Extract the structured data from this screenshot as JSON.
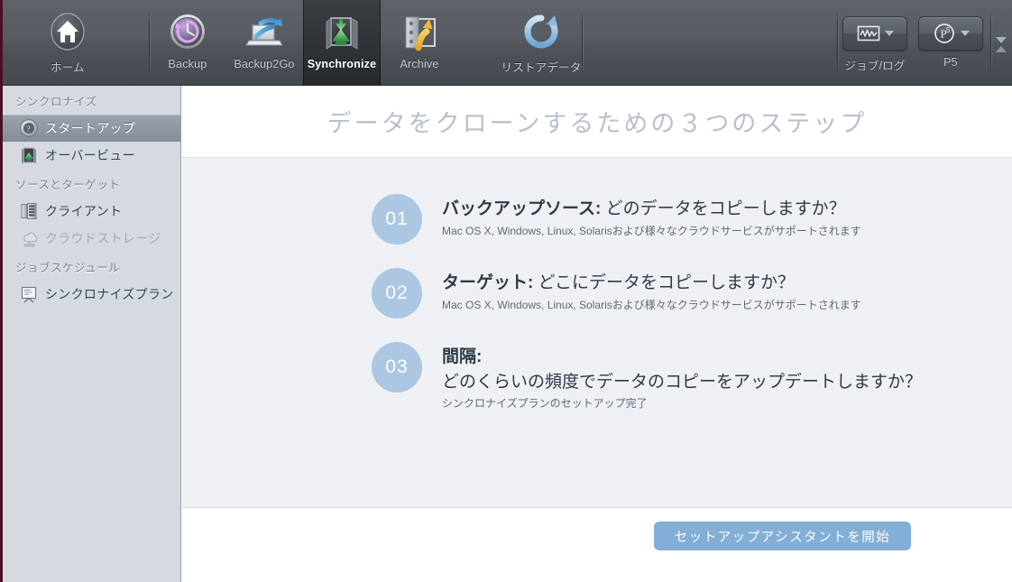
{
  "toolbar": {
    "items": [
      {
        "id": "home",
        "label": "ホーム",
        "icon": "home-icon",
        "active": false
      },
      {
        "id": "backup",
        "label": "Backup",
        "icon": "clock-backup-icon",
        "active": false
      },
      {
        "id": "backup2go",
        "label": "Backup2Go",
        "icon": "laptop-arrow-icon",
        "active": false
      },
      {
        "id": "synchronize",
        "label": "Synchronize",
        "icon": "sync-arrows-icon",
        "active": true
      },
      {
        "id": "archive",
        "label": "Archive",
        "icon": "safe-arrow-icon",
        "active": false
      },
      {
        "id": "restore",
        "label": "リストアデータ",
        "icon": "restore-arrow-icon",
        "active": false
      }
    ],
    "popups": [
      {
        "id": "joblog",
        "label": "ジョブ/ログ",
        "icon": "waveform-icon"
      },
      {
        "id": "p5",
        "label": "P5",
        "icon": "p5-icon"
      }
    ],
    "scroller_icon": "toolbar-scroll-icon"
  },
  "sidebar": {
    "groups": [
      {
        "title": "シンクロナイズ",
        "items": [
          {
            "label": "スタートアップ",
            "icon": "question-disc-icon",
            "selected": true,
            "disabled": false
          },
          {
            "label": "オーバービュー",
            "icon": "sync-overview-icon",
            "selected": false,
            "disabled": false
          }
        ]
      },
      {
        "title": "ソースとターゲット",
        "items": [
          {
            "label": "クライアント",
            "icon": "server-rack-icon",
            "selected": false,
            "disabled": false
          },
          {
            "label": "クラウドストレージ",
            "icon": "cloud-storage-icon",
            "selected": false,
            "disabled": true
          }
        ]
      },
      {
        "title": "ジョブスケジュール",
        "items": [
          {
            "label": "シンクロナイズプラン",
            "icon": "plan-board-icon",
            "selected": false,
            "disabled": false
          }
        ]
      }
    ]
  },
  "main": {
    "page_title": "データをクローンするための３つのステップ",
    "steps": [
      {
        "number": "01",
        "heading_bold": "バックアップソース:",
        "heading_rest": " どのデータをコピーしますか？",
        "heading_line2": "",
        "sub": "Mac OS X, Windows, Linux, Solarisおよび様々なクラウドサービスがサポートされます"
      },
      {
        "number": "02",
        "heading_bold": "ターゲット:",
        "heading_rest": " どこにデータをコピーしますか？",
        "heading_line2": "",
        "sub": "Mac OS X, Windows, Linux, Solarisおよび様々なクラウドサービスがサポートされます"
      },
      {
        "number": "03",
        "heading_bold": "間隔:",
        "heading_rest": "",
        "heading_line2": "どのくらいの頻度でデータのコピーをアップデートしますか？",
        "sub": "シンクロナイズプランのセットアップ完了"
      }
    ],
    "cta_label": "セットアップアシスタントを開始"
  },
  "colors": {
    "toolbar_bg": "#565c62",
    "toolbar_active": "#303438",
    "sidebar_bg": "#d5dae1",
    "sidebar_selected": "#8e98a3",
    "card_bg": "#eef0f4",
    "step_circle": "#abc7e2",
    "cta_bg": "#83aed6",
    "title_text": "#b9c0ca",
    "edge_accent": "#4a1020"
  }
}
